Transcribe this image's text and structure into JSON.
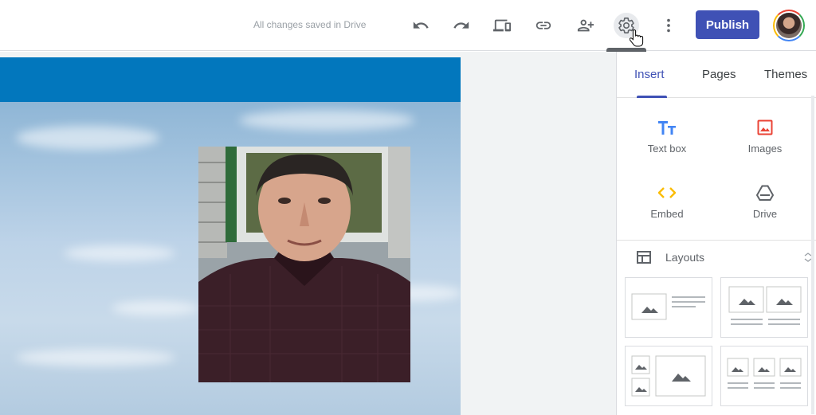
{
  "header": {
    "saved_status": "All changes saved in Drive",
    "publish_label": "Publish",
    "tooltip": "Settings",
    "icons": [
      "undo-icon",
      "redo-icon",
      "preview-icon",
      "link-icon",
      "share-icon",
      "settings-icon",
      "more-vert-icon"
    ]
  },
  "panel": {
    "tabs": [
      {
        "label": "Insert"
      },
      {
        "label": "Pages"
      },
      {
        "label": "Themes"
      }
    ],
    "insert_items": [
      {
        "label": "Text box",
        "icon": "text-box-icon",
        "color": "#4285f4"
      },
      {
        "label": "Images",
        "icon": "images-icon",
        "color": "#ea4335"
      },
      {
        "label": "Embed",
        "icon": "embed-icon",
        "color": "#fbbc04"
      },
      {
        "label": "Drive",
        "icon": "drive-icon",
        "color": "#5f6368"
      }
    ],
    "layouts_label": "Layouts"
  },
  "colors": {
    "accent": "#3f51b5",
    "page_header": "#0277bd"
  }
}
